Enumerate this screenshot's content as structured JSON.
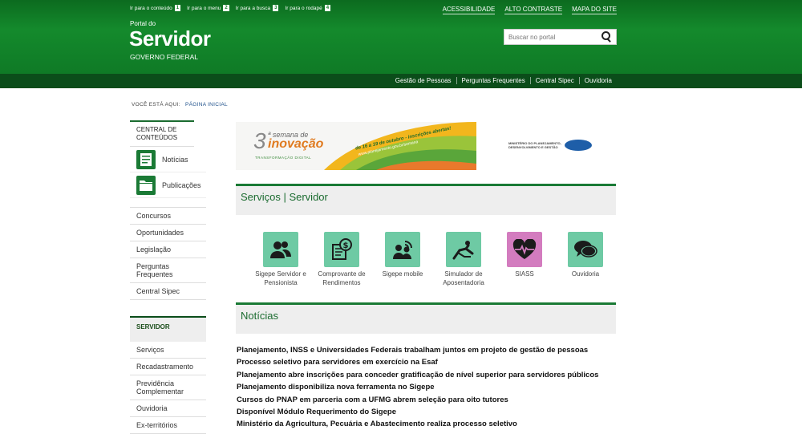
{
  "accessibility": {
    "items": [
      {
        "label": "Ir para o conteúdo",
        "key": "1"
      },
      {
        "label": "Ir para o menu",
        "key": "2"
      },
      {
        "label": "Ir para a busca",
        "key": "3"
      },
      {
        "label": "Ir para o rodapé",
        "key": "4"
      }
    ],
    "links": [
      "ACESSIBILIDADE",
      "ALTO CONTRASTE",
      "MAPA DO SITE"
    ]
  },
  "header": {
    "portal_label": "Portal do",
    "title": "Servidor",
    "subtitle": "GOVERNO FEDERAL",
    "search_placeholder": "Buscar no portal"
  },
  "service_links": [
    "Gestão de Pessoas",
    "Perguntas Frequentes",
    "Central Sipec",
    "Ouvidoria"
  ],
  "breadcrumb": {
    "prefix": "VOCÊ ESTÁ AQUI:",
    "current": "PÁGINA INICIAL"
  },
  "sidebar": {
    "central_heading": "CENTRAL DE CONTEÚDOS",
    "cards": [
      {
        "label": "Notícias",
        "icon": "document-icon"
      },
      {
        "label": "Publicações",
        "icon": "folder-icon"
      }
    ],
    "items": [
      "Concursos",
      "Oportunidades",
      "Legislação",
      "Perguntas Frequentes",
      "Central Sipec"
    ],
    "servidor_heading": "SERVIDOR",
    "servidor_items": [
      "Serviços",
      "Recadastramento",
      "Previdência Complementar",
      "Ouvidoria",
      "Ex-territórios"
    ]
  },
  "banner": {
    "number": "3",
    "line1": "ª semana de",
    "line2": "inovação",
    "tag": "TRANSFORMAÇÃO DIGITAL",
    "dates": "de 16 a 19 de outubro - inscrições abertas!",
    "url": "www.planejamento.gov.br/semana",
    "ministry": "MINISTÉRIO DO PLANEJAMENTO, DESENVOLVIMENTO E GESTÃO"
  },
  "services": {
    "heading": "Serviços | Servidor",
    "items": [
      {
        "label": "Sigepe Servidor e Pensionista",
        "icon": "users-icon"
      },
      {
        "label": "Comprovante de Rendimentos",
        "icon": "receipt-money-icon"
      },
      {
        "label": "Sigepe mobile",
        "icon": "mobile-people-icon"
      },
      {
        "label": "Simulador de Aposentadoria",
        "icon": "retirement-chair-icon"
      },
      {
        "label": "SIASS",
        "icon": "heart-pulse-icon"
      },
      {
        "label": "Ouvidoria",
        "icon": "speech-bubbles-icon"
      }
    ]
  },
  "news": {
    "heading": "Notícias",
    "items": [
      "Planejamento, INSS e Universidades Federais trabalham juntos em projeto de gestão de pessoas",
      "Processo seletivo para servidores em exercício na Esaf",
      "Planejamento abre inscrições para conceder gratificação de nível superior para servidores públicos",
      "Planejamento disponibiliza nova ferramenta no Sigepe",
      "Cursos do PNAP em parceria com a UFMG abrem seleção para oito tutores",
      "Disponível Módulo Requerimento do Sigepe",
      "Ministério da Agricultura, Pecuária e Abastecimento realiza processo seletivo"
    ]
  },
  "colors": {
    "header_green": "#148a2c",
    "bar_green": "#0b4d1a",
    "accent": "#1a7a35",
    "service_icon": "#6ecaa4",
    "siass_icon": "#d37cbf"
  }
}
